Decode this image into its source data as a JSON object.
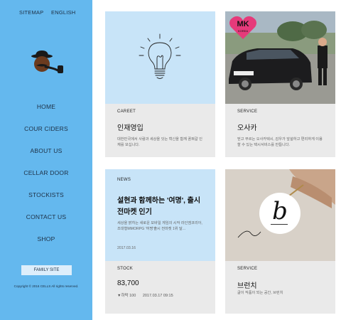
{
  "topnav": {
    "sitemap": "SITEMAP",
    "english": "ENGLISH"
  },
  "menu": [
    "HOME",
    "COUR CIDERS",
    "ABOUT US",
    "CELLAR DOOR",
    "STOCKISTS",
    "CONTACT US",
    "SHOP"
  ],
  "family_site": "FAMILY SITE",
  "copyright": "Copyright © 2016 CELLS All rights reserved.",
  "cards": {
    "career": {
      "category": "CAREET",
      "title": "인재영입",
      "desc": "대한민국에서 사람과 세상을 잇는 혁신을 함께 꿈꿔갈 인재를 모십니다."
    },
    "service": {
      "category": "SERVICE",
      "title": "오사카",
      "desc": "믿고 부르는 오사카택시, 감우가 앞설하고 편리하게 이용할 수 있는 택시서비스를 만듭니다.",
      "badge_main": "MK",
      "badge_sub": "KOREA"
    },
    "news": {
      "category": "NEWS",
      "title": "설현과 함께하는 '여명', 출시 전마켓 인기",
      "desc": "세상을 밝히는 새로운 모바일 게임의 시작 라인엠코리아, 조대형MMORPG '여명'출시 전마켓 1위 달...",
      "date": "2017.03.16"
    },
    "stock": {
      "category": "STOCK",
      "price": "83,700",
      "change": "▼하락 100",
      "datetime": "2017.03.17 09:15"
    },
    "branch": {
      "category": "SERVICE",
      "title": "브런치",
      "desc": "글이 작품이 되는 공간, 브런치",
      "logo_letter": "b"
    }
  }
}
